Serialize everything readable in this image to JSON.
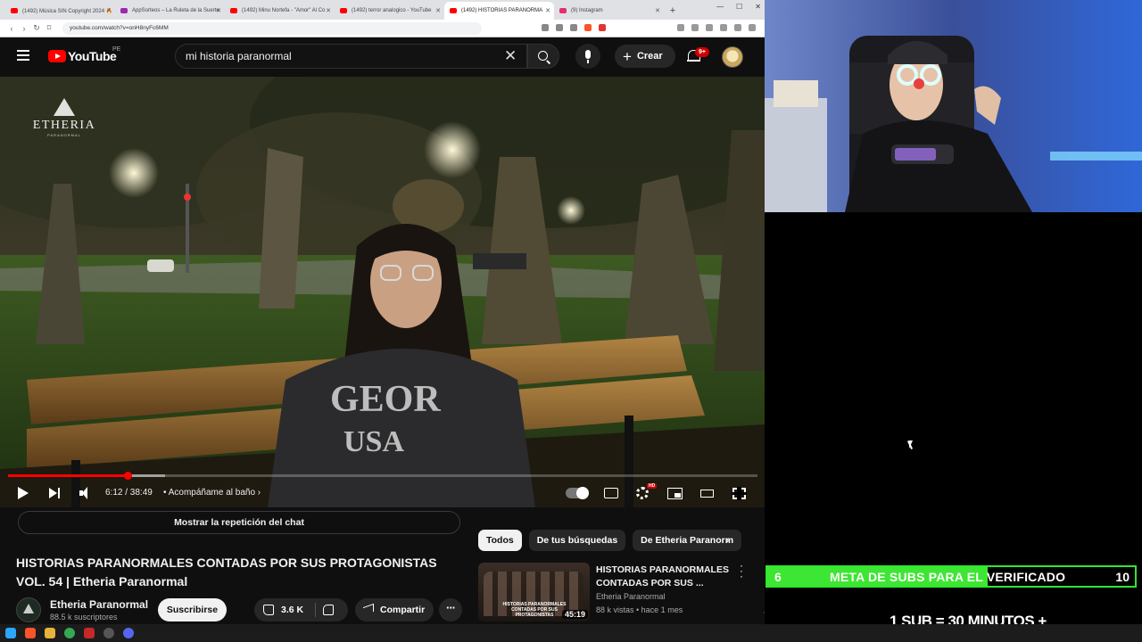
{
  "browser": {
    "tabs": [
      {
        "label": "(1492) Música SIN Copyright 2024 🔥",
        "fav": "#ff0000",
        "active": false
      },
      {
        "label": "AppSorteos – La Ruleta de la Suerte",
        "fav": "#9c27b0",
        "active": false
      },
      {
        "label": "(1492) Minu Nortefa - \"Amor\" Al Co",
        "fav": "#ff0000",
        "active": false
      },
      {
        "label": "(1492) terror analogico - YouTube",
        "fav": "#ff0000",
        "active": false
      },
      {
        "label": "(1492) HISTORIAS PARANORMA",
        "fav": "#ff0000",
        "active": true
      },
      {
        "label": "(9) Instagram",
        "fav": "#e1306c",
        "active": false
      }
    ],
    "new_tab": "+",
    "url": "youtube.com/watch?v=onH8nyFc6MM"
  },
  "youtube": {
    "logo_text": "YouTube",
    "country": "PE",
    "search_query": "mi historia paranormal",
    "create_label": "Crear",
    "notif_badge": "9+"
  },
  "player": {
    "watermark": "ETHERIA",
    "watermark_sub": "PARANORMAL",
    "time": "6:12 / 38:49",
    "chapter": "• Acompáñame al baño",
    "progress": 0.16,
    "buffered": 0.21
  },
  "video": {
    "chat_replay": "Mostrar la repetición del chat",
    "title": "HISTORIAS PARANORMALES CONTADAS POR SUS PROTAGONISTAS VOL. 54 | Etheria Paranormal",
    "channel": "Etheria Paranormal",
    "subscribers": "88.5 k suscriptores",
    "subscribe_label": "Suscribirse",
    "likes": "3.6 K",
    "share_label": "Compartir"
  },
  "sidebar": {
    "chips": [
      "Todos",
      "De tus búsquedas",
      "De Etheria Paranorm"
    ],
    "recommendation": {
      "title": "HISTORIAS PARANORMALES CONTADAS POR SUS ...",
      "channel": "Etheria Paranormal",
      "meta": "88 k vistas • hace 1 mes",
      "duration": "45:19",
      "thumb_text": "HISTORIAS PARANORMALES CONTADAS POR SUS PROTAGONISTAS"
    }
  },
  "stream_overlay": {
    "goal_start": "6",
    "goal_label": "META DE SUBS PARA EL VERIFICADO",
    "goal_end": "10",
    "goal_progress": 0.6,
    "sub_rule": "1 SUB  =  30 MINUTOS +"
  },
  "colors": {
    "yt_red": "#ff0000",
    "goal_green": "#3de632"
  }
}
